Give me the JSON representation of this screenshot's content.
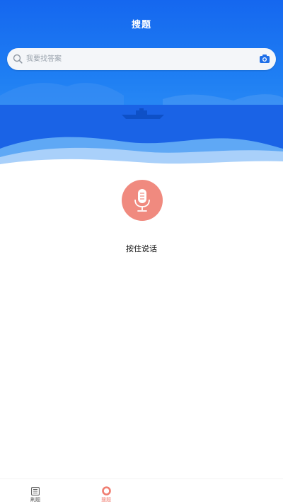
{
  "header": {
    "title": "搜题"
  },
  "search": {
    "placeholder": "我要找答案"
  },
  "voice": {
    "hold_label": "按住说话"
  },
  "bottom_nav": {
    "items": [
      {
        "label": "刷题",
        "icon": "list-icon",
        "active": false
      },
      {
        "label": "搜题",
        "icon": "search-circle-icon",
        "active": true
      }
    ]
  },
  "colors": {
    "primary_blue": "#1567ef",
    "mic_red": "#f08a7f",
    "active_tab": "#f07d70"
  }
}
